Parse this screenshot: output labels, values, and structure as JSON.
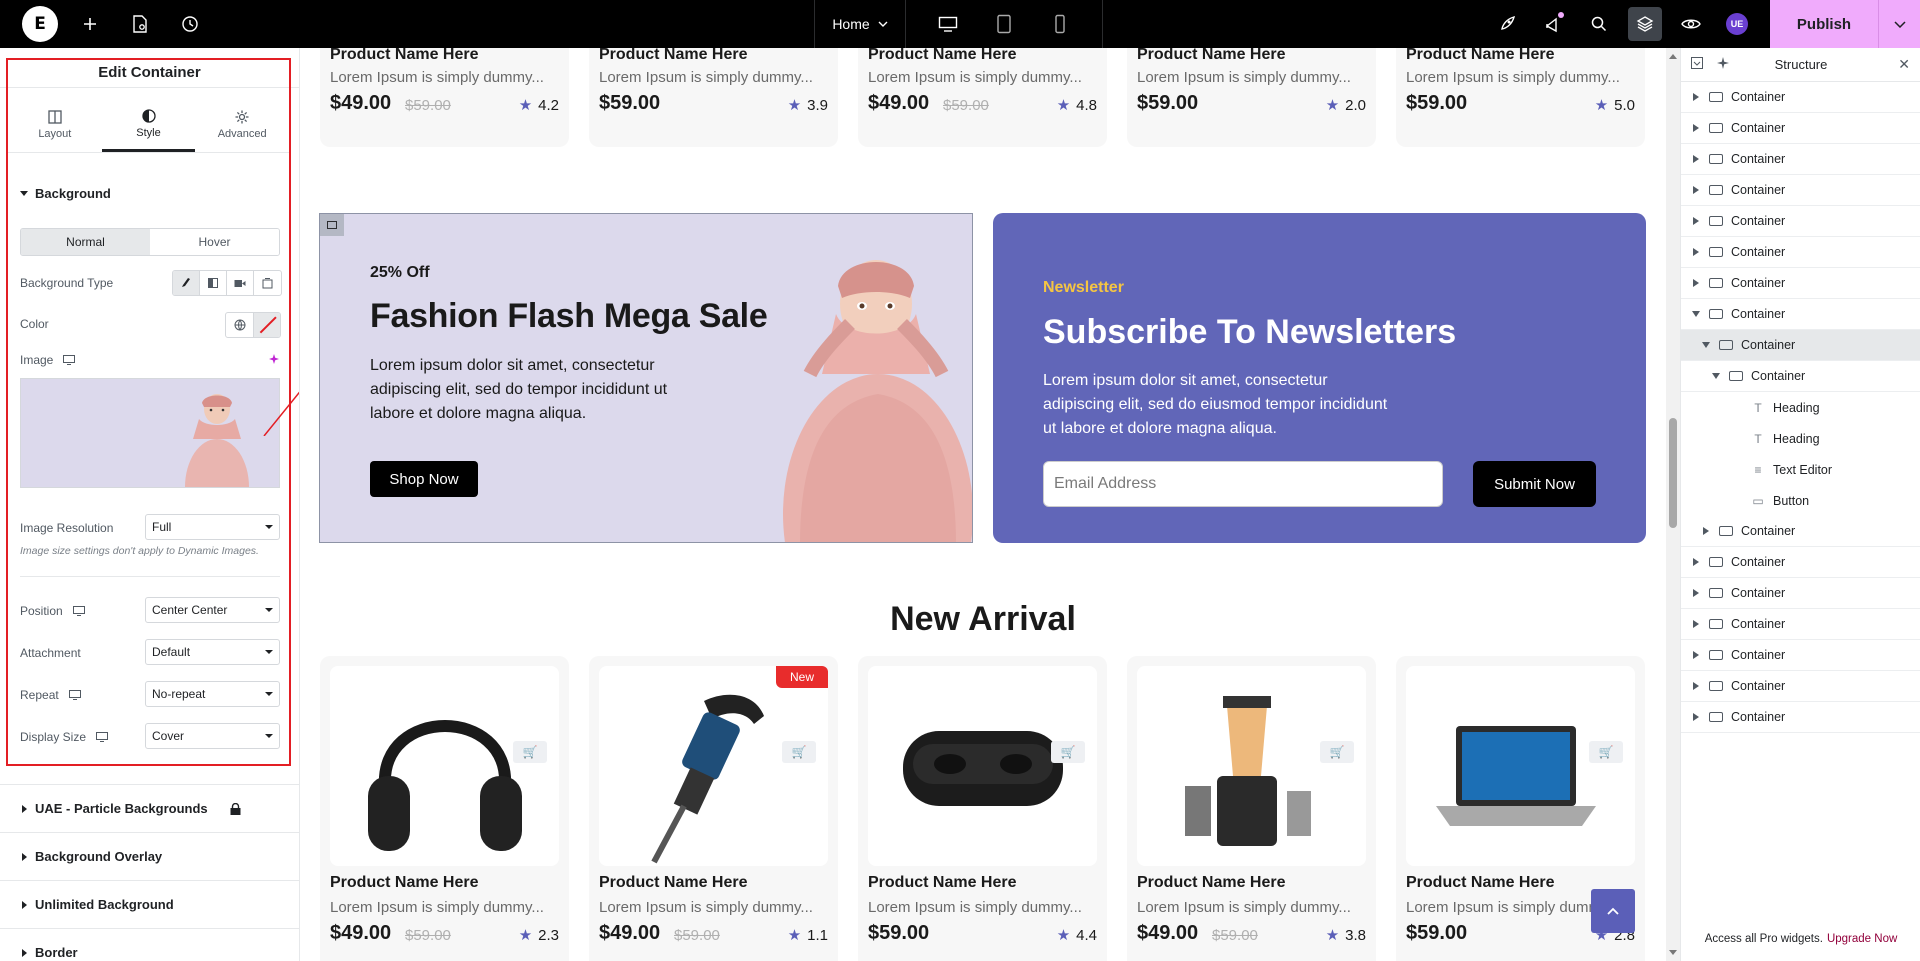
{
  "topbar": {
    "page_label": "Home",
    "publish_label": "Publish",
    "user_initials": "UE"
  },
  "left_panel": {
    "title": "Edit Container",
    "tabs": [
      {
        "label": "Layout",
        "icon": "layout-icon"
      },
      {
        "label": "Style",
        "icon": "half-circle-icon"
      },
      {
        "label": "Advanced",
        "icon": "gear-icon"
      }
    ],
    "active_tab": "Style",
    "background_section": "Background",
    "normal_label": "Normal",
    "hover_label": "Hover",
    "background_type_label": "Background Type",
    "color_label": "Color",
    "image_label": "Image",
    "image_resolution_label": "Image Resolution",
    "image_resolution_value": "Full",
    "image_hint": "Image size settings don't apply to Dynamic Images.",
    "position_label": "Position",
    "position_value": "Center Center",
    "attachment_label": "Attachment",
    "attachment_value": "Default",
    "repeat_label": "Repeat",
    "repeat_value": "No-repeat",
    "display_size_label": "Display Size",
    "display_size_value": "Cover",
    "collapsed_sections": [
      "UAE - Particle Backgrounds",
      "Background Overlay",
      "Unlimited Background",
      "Border"
    ]
  },
  "canvas": {
    "top_products": [
      {
        "name": "Product Name Here",
        "desc": "Lorem Ipsum is simply dummy...",
        "price": "$49.00",
        "old_price": "$59.00",
        "rating": "4.2"
      },
      {
        "name": "Product Name Here",
        "desc": "Lorem Ipsum is simply dummy...",
        "price": "$59.00",
        "old_price": "",
        "rating": "3.9"
      },
      {
        "name": "Product Name Here",
        "desc": "Lorem Ipsum is simply dummy...",
        "price": "$49.00",
        "old_price": "$59.00",
        "rating": "4.8"
      },
      {
        "name": "Product Name Here",
        "desc": "Lorem Ipsum is simply dummy...",
        "price": "$59.00",
        "old_price": "",
        "rating": "2.0"
      },
      {
        "name": "Product Name Here",
        "desc": "Lorem Ipsum is simply dummy...",
        "price": "$59.00",
        "old_price": "",
        "rating": "5.0"
      }
    ],
    "promo": {
      "offer": "25% Off",
      "title": "Fashion Flash Mega Sale",
      "text": "Lorem ipsum dolor sit amet, consectetur adipiscing elit, sed do tempor incididunt ut labore et dolore magna aliqua.",
      "button": "Shop Now"
    },
    "newsletter": {
      "eyebrow": "Newsletter",
      "title": "Subscribe To Newsletters",
      "text": "Lorem ipsum dolor sit amet, consectetur adipiscing elit, sed do eiusmod tempor incididunt ut labore et dolore magna aliqua.",
      "email_placeholder": "Email Address",
      "button": "Submit Now"
    },
    "new_arrival_title": "New Arrival",
    "new_badge": "New",
    "new_products": [
      {
        "name": "Product Name Here",
        "desc": "Lorem Ipsum is simply dummy...",
        "price": "$49.00",
        "old_price": "$59.00",
        "rating": "2.3",
        "image": "headphones"
      },
      {
        "name": "Product Name Here",
        "desc": "Lorem Ipsum is simply dummy...",
        "price": "$49.00",
        "old_price": "$59.00",
        "rating": "1.1",
        "image": "jackhammer"
      },
      {
        "name": "Product Name Here",
        "desc": "Lorem Ipsum is simply dummy...",
        "price": "$59.00",
        "old_price": "",
        "rating": "4.4",
        "image": "earbuds"
      },
      {
        "name": "Product Name Here",
        "desc": "Lorem Ipsum is simply dummy...",
        "price": "$49.00",
        "old_price": "$59.00",
        "rating": "3.8",
        "image": "blender"
      },
      {
        "name": "Product Name Here",
        "desc": "Lorem Ipsum is simply dumm",
        "price": "$59.00",
        "old_price": "",
        "rating": "2.8",
        "image": "laptop"
      }
    ]
  },
  "structure": {
    "title": "Structure",
    "nodes": [
      {
        "label": "Container",
        "depth": 0,
        "caret": "right",
        "type": "container"
      },
      {
        "label": "Container",
        "depth": 0,
        "caret": "right",
        "type": "container"
      },
      {
        "label": "Container",
        "depth": 0,
        "caret": "right",
        "type": "container"
      },
      {
        "label": "Container",
        "depth": 0,
        "caret": "right",
        "type": "container"
      },
      {
        "label": "Container",
        "depth": 0,
        "caret": "right",
        "type": "container"
      },
      {
        "label": "Container",
        "depth": 0,
        "caret": "right",
        "type": "container"
      },
      {
        "label": "Container",
        "depth": 0,
        "caret": "right",
        "type": "container"
      },
      {
        "label": "Container",
        "depth": 0,
        "caret": "down",
        "type": "container"
      },
      {
        "label": "Container",
        "depth": 1,
        "caret": "down",
        "type": "container",
        "selected": true
      },
      {
        "label": "Container",
        "depth": 2,
        "caret": "down",
        "type": "container"
      },
      {
        "label": "Heading",
        "depth": 3,
        "caret": "",
        "type": "heading"
      },
      {
        "label": "Heading",
        "depth": 3,
        "caret": "",
        "type": "heading"
      },
      {
        "label": "Text Editor",
        "depth": 3,
        "caret": "",
        "type": "text"
      },
      {
        "label": "Button",
        "depth": 3,
        "caret": "",
        "type": "button"
      },
      {
        "label": "Container",
        "depth": 1,
        "caret": "right",
        "type": "container"
      },
      {
        "label": "Container",
        "depth": 0,
        "caret": "right",
        "type": "container"
      },
      {
        "label": "Container",
        "depth": 0,
        "caret": "right",
        "type": "container"
      },
      {
        "label": "Container",
        "depth": 0,
        "caret": "right",
        "type": "container"
      },
      {
        "label": "Container",
        "depth": 0,
        "caret": "right",
        "type": "container"
      },
      {
        "label": "Container",
        "depth": 0,
        "caret": "right",
        "type": "container"
      },
      {
        "label": "Container",
        "depth": 0,
        "caret": "right",
        "type": "container"
      }
    ],
    "footer_text": "Access all Pro widgets.",
    "footer_link": "Upgrade Now"
  },
  "colors": {
    "accent": "#5b5fb8",
    "publish_bg": "#f0abfc",
    "highlight_border": "#e31e24",
    "newsletter_bg": "#6166b8",
    "newsletter_eyebrow": "#f5c542",
    "promo_bg": "#dcd9ec",
    "new_badge": "#e82c2c"
  }
}
